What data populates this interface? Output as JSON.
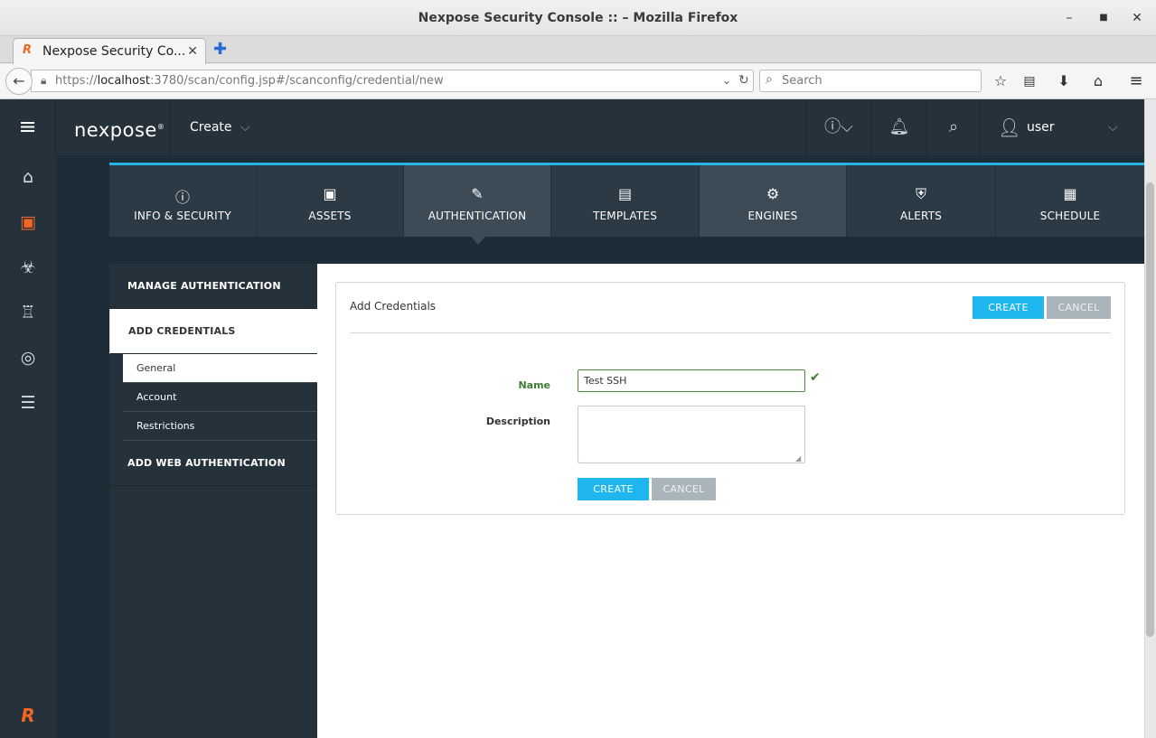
{
  "window": {
    "title": "Nexpose Security Console :: – Mozilla Firefox",
    "minimize": "–",
    "maximize": "■",
    "close": "✕"
  },
  "browser": {
    "tab_label": "Nexpose Security Co...",
    "tab_close": "✕",
    "new_tab": "✚",
    "url_host": "localhost",
    "url_prefix": "https://",
    "url_rest": ":3780/scan/config.jsp#/scanconfig/credential/new",
    "search_placeholder": "Search"
  },
  "header": {
    "logo": "nexpose",
    "create_menu": "Create",
    "username": "user"
  },
  "steps": [
    {
      "label": "INFO & SECURITY",
      "icon": "info-icon"
    },
    {
      "label": "ASSETS",
      "icon": "assets-icon"
    },
    {
      "label": "AUTHENTICATION",
      "icon": "authentication-icon"
    },
    {
      "label": "TEMPLATES",
      "icon": "templates-icon"
    },
    {
      "label": "ENGINES",
      "icon": "engines-icon"
    },
    {
      "label": "ALERTS",
      "icon": "alerts-icon"
    },
    {
      "label": "SCHEDULE",
      "icon": "schedule-icon"
    }
  ],
  "subnav": {
    "manage": "MANAGE AUTHENTICATION",
    "add_credentials": "ADD CREDENTIALS",
    "general": "General",
    "account": "Account",
    "restrictions": "Restrictions",
    "add_web": "ADD WEB AUTHENTICATION"
  },
  "form": {
    "title": "Add Credentials",
    "create": "CREATE",
    "cancel": "CANCEL",
    "name_label": "Name",
    "name_value": "Test SSH",
    "description_label": "Description",
    "description_value": ""
  },
  "colors": {
    "accent": "#1fb6f0",
    "valid": "#3e7b33",
    "header_bg": "#26323b",
    "brand": "#f26522"
  }
}
